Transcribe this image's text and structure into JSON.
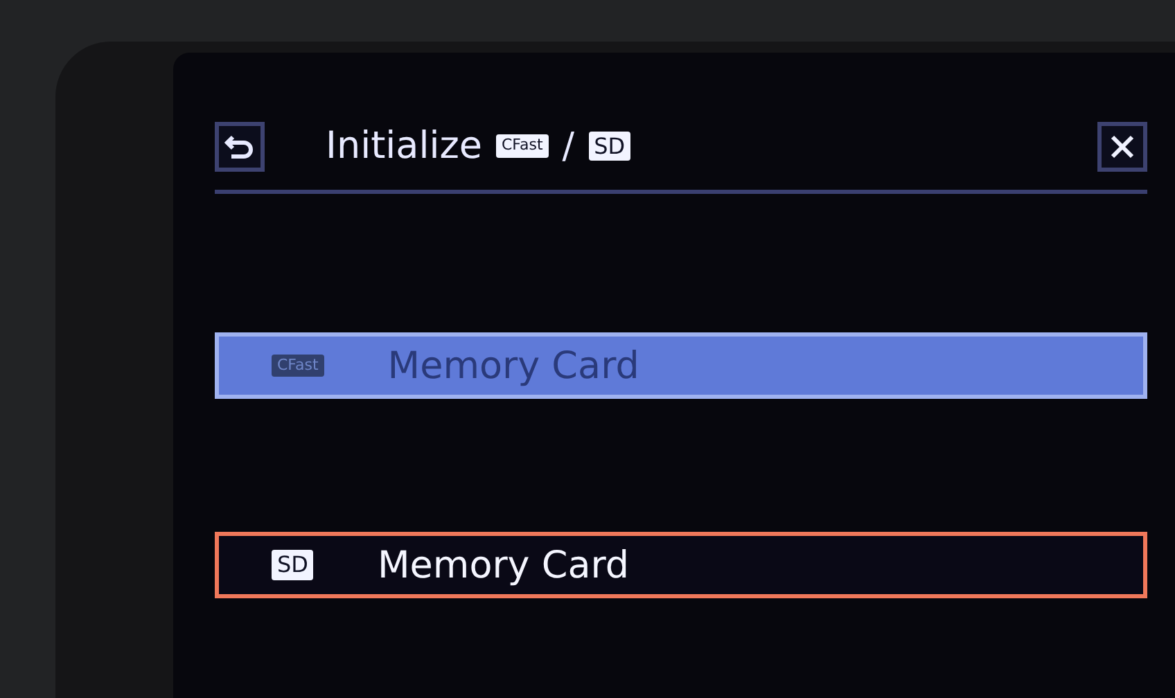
{
  "header": {
    "title": "Initialize",
    "media": [
      "CFast",
      "SD"
    ],
    "separator": "/"
  },
  "items": [
    {
      "badge": "CFast",
      "label": "Memory Card",
      "disabled": true,
      "focused": false
    },
    {
      "badge": "SD",
      "label": "Memory Card",
      "disabled": false,
      "focused": true
    }
  ]
}
